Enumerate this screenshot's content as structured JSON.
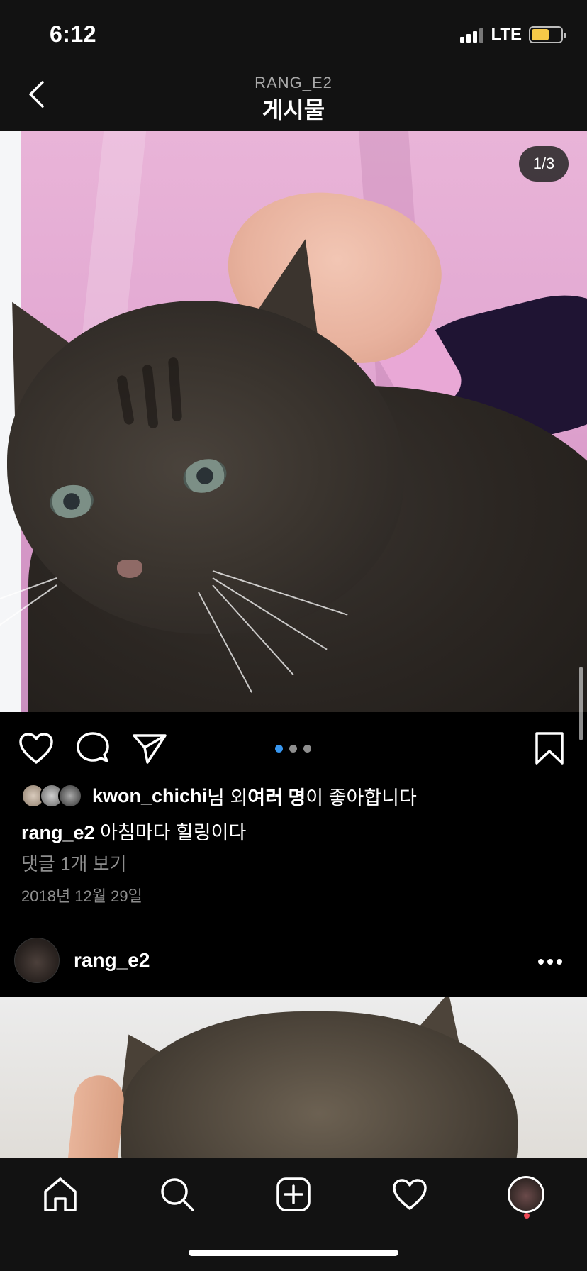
{
  "status_bar": {
    "time": "6:12",
    "network": "LTE",
    "battery_color": "#f7c948",
    "battery_level": 0.55,
    "signal_bars": 3
  },
  "header": {
    "subtitle": "RANG_E2",
    "title": "게시물",
    "back_icon": "chevron-left-icon"
  },
  "post": {
    "photo_counter": "1/3",
    "carousel_total": 3,
    "carousel_active": 0,
    "accent_color": "#3897f0",
    "actions": [
      "heart-icon",
      "comment-icon",
      "send-icon",
      "bookmark-icon"
    ],
    "likes": {
      "user": "kwon_chichi",
      "suffix_1": "님 외 ",
      "others": "여러 명",
      "suffix_2": "이 좋아합니다"
    },
    "caption": {
      "username": "rang_e2",
      "text": " 아침마다 힐링이다"
    },
    "view_comments": "댓글 1개 보기",
    "date": "2018년 12월 29일"
  },
  "next_post": {
    "username": "rang_e2",
    "more_icon": "more-horizontal-icon"
  },
  "bottom_nav": {
    "items": [
      "home-icon",
      "search-icon",
      "add-post-icon",
      "activity-heart-icon",
      "profile-avatar"
    ],
    "notification_color": "#ed4956"
  }
}
